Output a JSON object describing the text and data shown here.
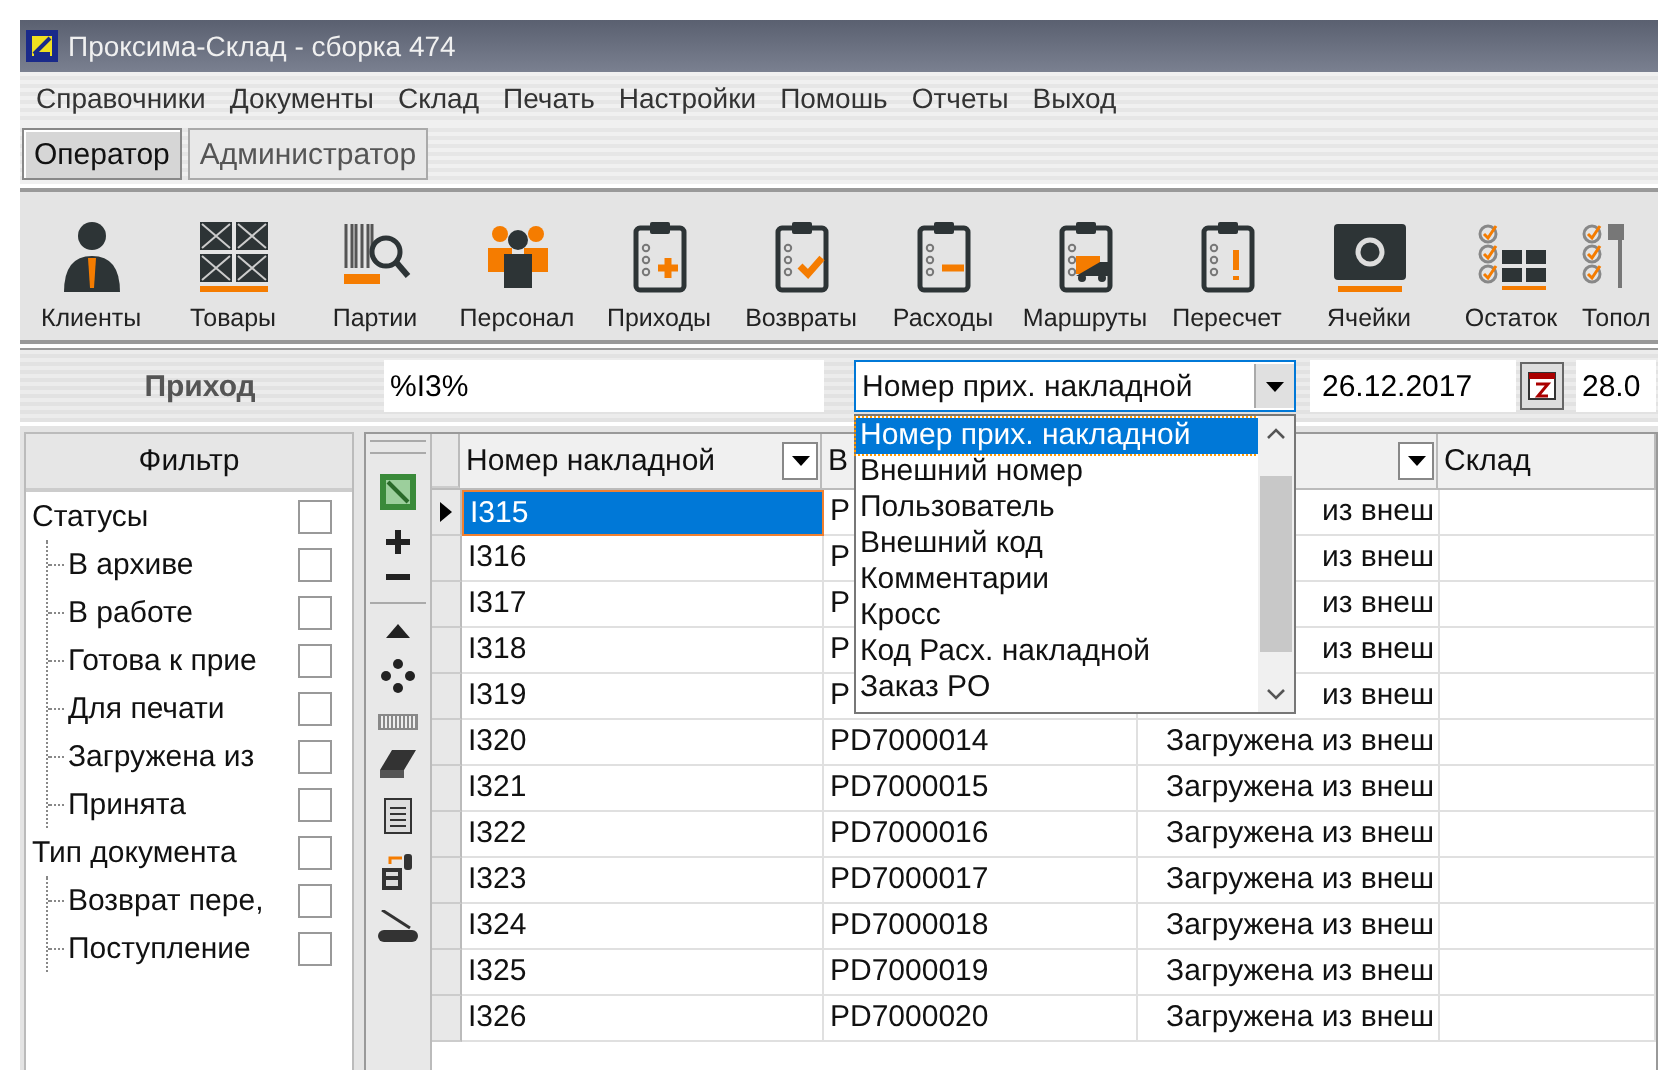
{
  "window": {
    "title": "Проксима-Склад - сборка 474"
  },
  "menu": [
    "Справочники",
    "Документы",
    "Склад",
    "Печать",
    "Настройки",
    "Помошь",
    "Отчеты",
    "Выход"
  ],
  "roles": [
    {
      "label": "Оператор",
      "selected": true
    },
    {
      "label": "Администратор",
      "selected": false
    }
  ],
  "toolbar": [
    "Клиенты",
    "Товары",
    "Партии",
    "Персонал",
    "Приходы",
    "Возвраты",
    "Расходы",
    "Маршруты",
    "Пересчет",
    "Ячейки",
    "Остаток",
    "Топол"
  ],
  "document": {
    "title": "Приход",
    "search": "%I3%",
    "date_from": "26.12.2017",
    "date_to": "28.0",
    "field": {
      "value": "Номер прих. накладной",
      "expanded": true,
      "options": [
        {
          "label": "Номер прих. накладной",
          "selected": true
        },
        {
          "label": "Внешний номер",
          "selected": false
        },
        {
          "label": "Пользователь",
          "selected": false
        },
        {
          "label": "Внешний код",
          "selected": false
        },
        {
          "label": "Комментарии",
          "selected": false
        },
        {
          "label": "Кросс",
          "selected": false
        },
        {
          "label": "Код Расх. накладной",
          "selected": false
        },
        {
          "label": "Заказ PO",
          "selected": false
        }
      ]
    }
  },
  "filter": {
    "title": "Фильтр",
    "groups": [
      {
        "label": "Статусы",
        "checked": false,
        "children": [
          {
            "label": "В архиве",
            "checked": false
          },
          {
            "label": "В работе",
            "checked": false
          },
          {
            "label": "Готова к прие",
            "checked": false
          },
          {
            "label": "Для печати",
            "checked": false
          },
          {
            "label": "Загружена из",
            "checked": false
          },
          {
            "label": "Принята",
            "checked": false
          }
        ]
      },
      {
        "label": "Тип документа",
        "checked": false,
        "children": [
          {
            "label": "Возврат пере,",
            "checked": false
          },
          {
            "label": "Поступление",
            "checked": false
          }
        ]
      }
    ]
  },
  "table": {
    "columns": [
      {
        "label": "Номер накладной",
        "filter": true
      },
      {
        "label": "В",
        "filter": false
      },
      {
        "filter": true
      },
      {
        "label": "Склад",
        "filter": false
      }
    ],
    "rows": [
      {
        "selected": true,
        "cells": [
          "I315",
          "P",
          "из внеш"
        ]
      },
      {
        "selected": false,
        "cells": [
          "I316",
          "P",
          "из внеш"
        ]
      },
      {
        "selected": false,
        "cells": [
          "I317",
          "P",
          "из внеш"
        ]
      },
      {
        "selected": false,
        "cells": [
          "I318",
          "P",
          "из внеш"
        ]
      },
      {
        "selected": false,
        "cells": [
          "I319",
          "P",
          "из внеш"
        ]
      },
      {
        "selected": false,
        "cells": [
          "I320",
          "PD7000014",
          "Загружена из внеш"
        ]
      },
      {
        "selected": false,
        "cells": [
          "I321",
          "PD7000015",
          "Загружена из внеш"
        ]
      },
      {
        "selected": false,
        "cells": [
          "I322",
          "PD7000016",
          "Загружена из внеш"
        ]
      },
      {
        "selected": false,
        "cells": [
          "I323",
          "PD7000017",
          "Загружена из внеш"
        ]
      },
      {
        "selected": false,
        "cells": [
          "I324",
          "PD7000018",
          "Загружена из внеш"
        ]
      },
      {
        "selected": false,
        "cells": [
          "I325",
          "PD7000019",
          "Загружена из внеш"
        ]
      },
      {
        "selected": false,
        "cells": [
          "I326",
          "PD7000020",
          "Загружена из внеш"
        ]
      }
    ]
  }
}
